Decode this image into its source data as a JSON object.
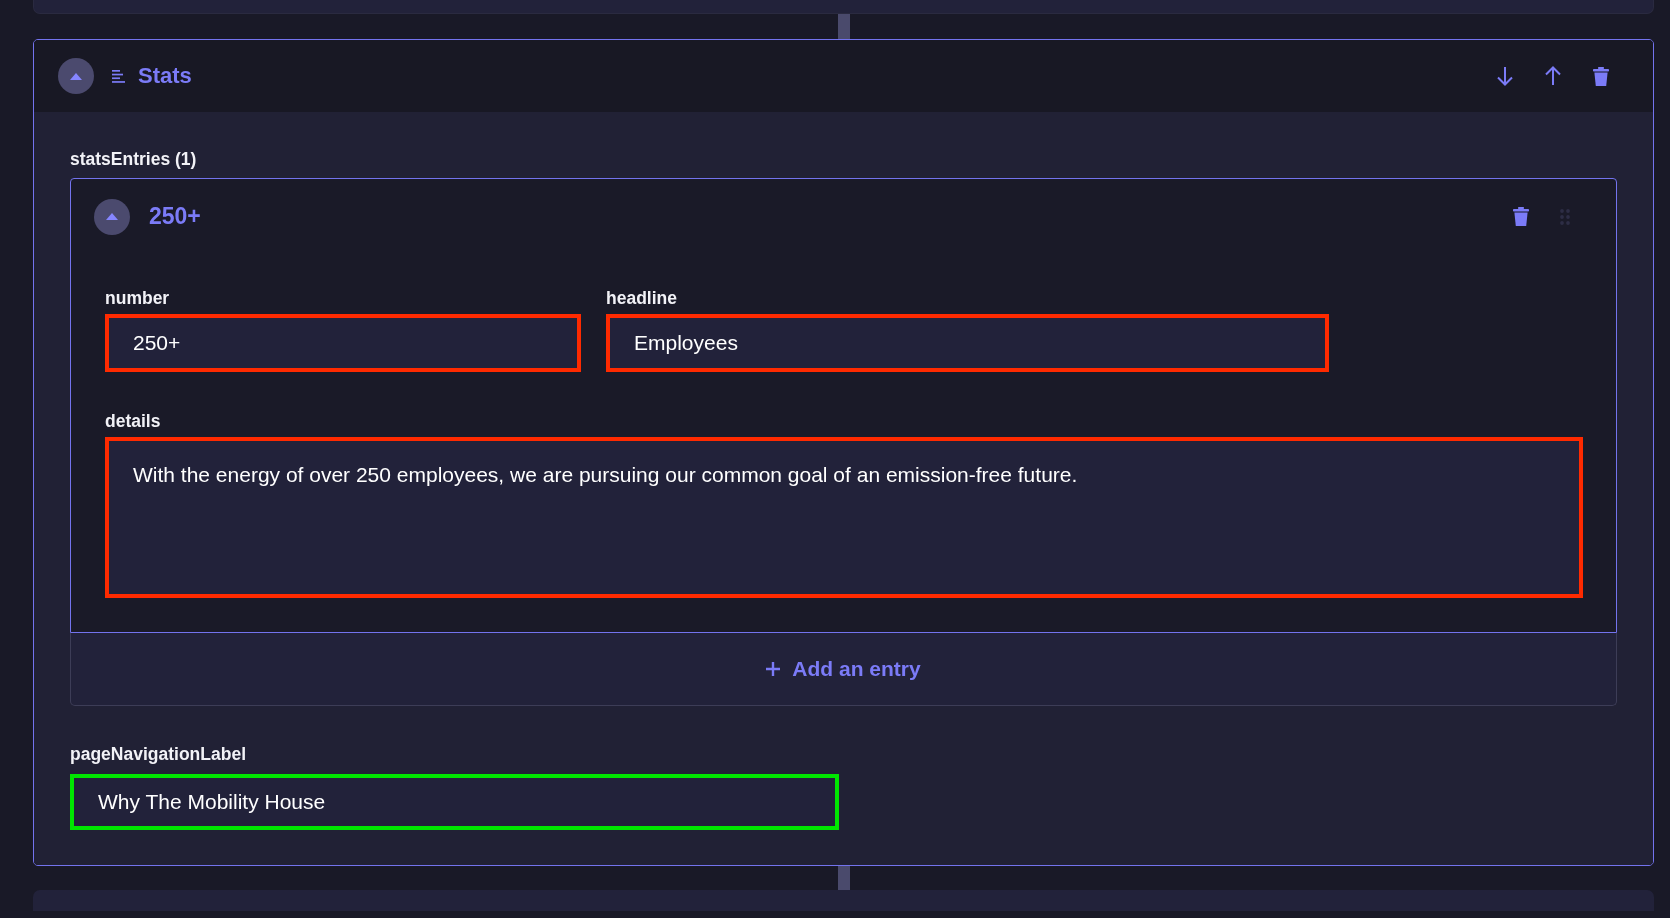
{
  "section": {
    "title": "Stats",
    "expanded": true,
    "list": {
      "label": "statsEntries (1)",
      "entries": [
        {
          "title": "250+",
          "expanded": true,
          "fields": [
            {
              "kind": "text",
              "label": "number",
              "value": "250+",
              "color": "#ff2a00"
            },
            {
              "kind": "text",
              "label": "headline",
              "value": "Employees",
              "color": "#ff2a00"
            },
            {
              "kind": "textarea",
              "label": "details",
              "value": "With the energy of over 250 employees, we are pursuing our common goal of an emission-free future.",
              "color": "#ff2a00"
            }
          ]
        }
      ],
      "add_button": "Add an entry"
    },
    "fields": [
      {
        "kind": "text",
        "label": "pageNavigationLabel",
        "value": "Why The Mobility House",
        "color": "#00e600"
      }
    ]
  }
}
